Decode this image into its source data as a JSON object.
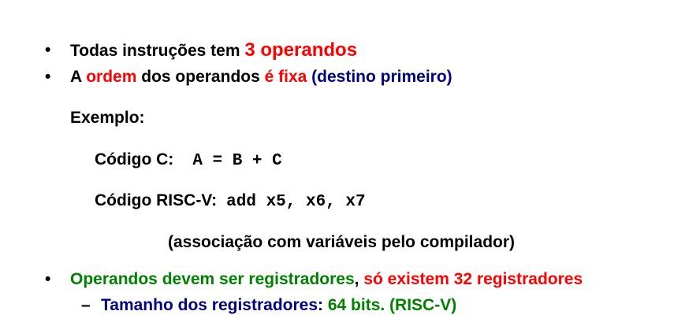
{
  "bullet_symbol": "•",
  "dash_symbol": "–",
  "bullet1": {
    "text": "Todas instruções tem ",
    "highlight": "3 operandos"
  },
  "bullet2": {
    "part1": "A ",
    "part2": "ordem",
    "part3": " dos operandos ",
    "part4": "é fixa",
    "part5": " (destino primeiro)"
  },
  "example": {
    "heading": "Exemplo:",
    "c_label": "Código C:",
    "c_code": "A = B + C",
    "risc_label": "Código RISC-V:",
    "risc_code": "add x5, x6, x7",
    "note": "(associação com variáveis pelo compilador)"
  },
  "bullet3": {
    "part1": "Operandos devem ser registradores",
    "part2": ", ",
    "part3": "só existem 32 registradores"
  },
  "sub_bullet": {
    "part1": "Tamanho dos registradores: ",
    "part2": "64 bits. (RISC-V)"
  },
  "colors": {
    "red": "#ff0000",
    "navy": "#000080",
    "green": "#008000",
    "black": "#000000"
  }
}
